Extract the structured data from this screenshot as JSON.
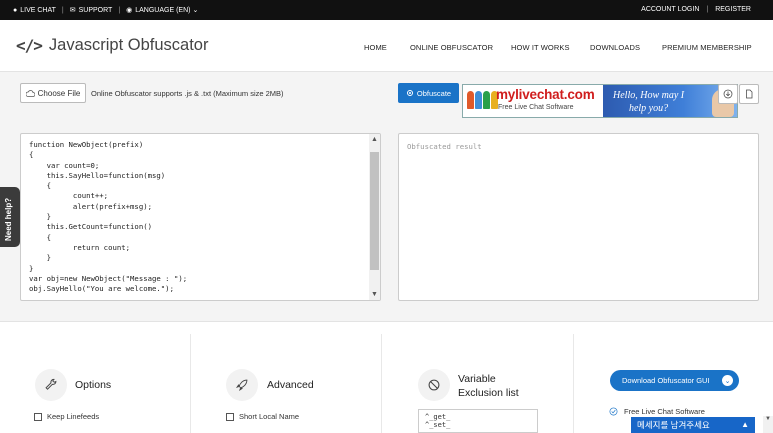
{
  "topbar": {
    "live_chat": "LIVE CHAT",
    "support": "SUPPORT",
    "language": "LANGUAGE (EN)",
    "account_login": "ACCOUNT LOGIN",
    "register": "REGISTER"
  },
  "header": {
    "logo_code": "</>",
    "title": "Javascript Obfuscator",
    "nav": [
      "HOME",
      "ONLINE OBFUSCATOR",
      "HOW IT WORKS",
      "DOWNLOADS",
      "PREMIUM MEMBERSHIP"
    ]
  },
  "toolbar": {
    "choose_file": "Choose File",
    "support_note": "Online Obfuscator supports .js & .txt (Maximum size 2MB)",
    "obfuscate": "Obfuscate"
  },
  "ad": {
    "brand": "mylivechat.com",
    "subtitle": "Free Live Chat Software",
    "tagline_line1": "Hello, How may I",
    "tagline_line2": "help you?"
  },
  "editor": {
    "code": "function NewObject(prefix)\n{\n    var count=0;\n    this.SayHello=function(msg)\n    {\n          count++;\n          alert(prefix+msg);\n    }\n    this.GetCount=function()\n    {\n          return count;\n    }\n}\nvar obj=new NewObject(\"Message : \");\nobj.SayHello(\"You are welcome.\");"
  },
  "result": {
    "placeholder": "Obfuscated result"
  },
  "need_help": "Need help?",
  "sections": {
    "options": {
      "title": "Options",
      "checkbox": "Keep Linefeeds"
    },
    "advanced": {
      "title": "Advanced",
      "checkbox": "Short Local Name"
    },
    "exclusion": {
      "title_line1": "Variable",
      "title_line2": "Exclusion list",
      "items": "^_get_\n^_set_"
    }
  },
  "download": {
    "button": "Download Obfuscator GUI",
    "feature": "Free Live Chat Software"
  },
  "chat_widget": {
    "label": "메세지를 남겨주세요"
  },
  "colors": {
    "accent": "#1a73c7",
    "topbar": "#111111",
    "brand_red": "#d01e1e"
  }
}
